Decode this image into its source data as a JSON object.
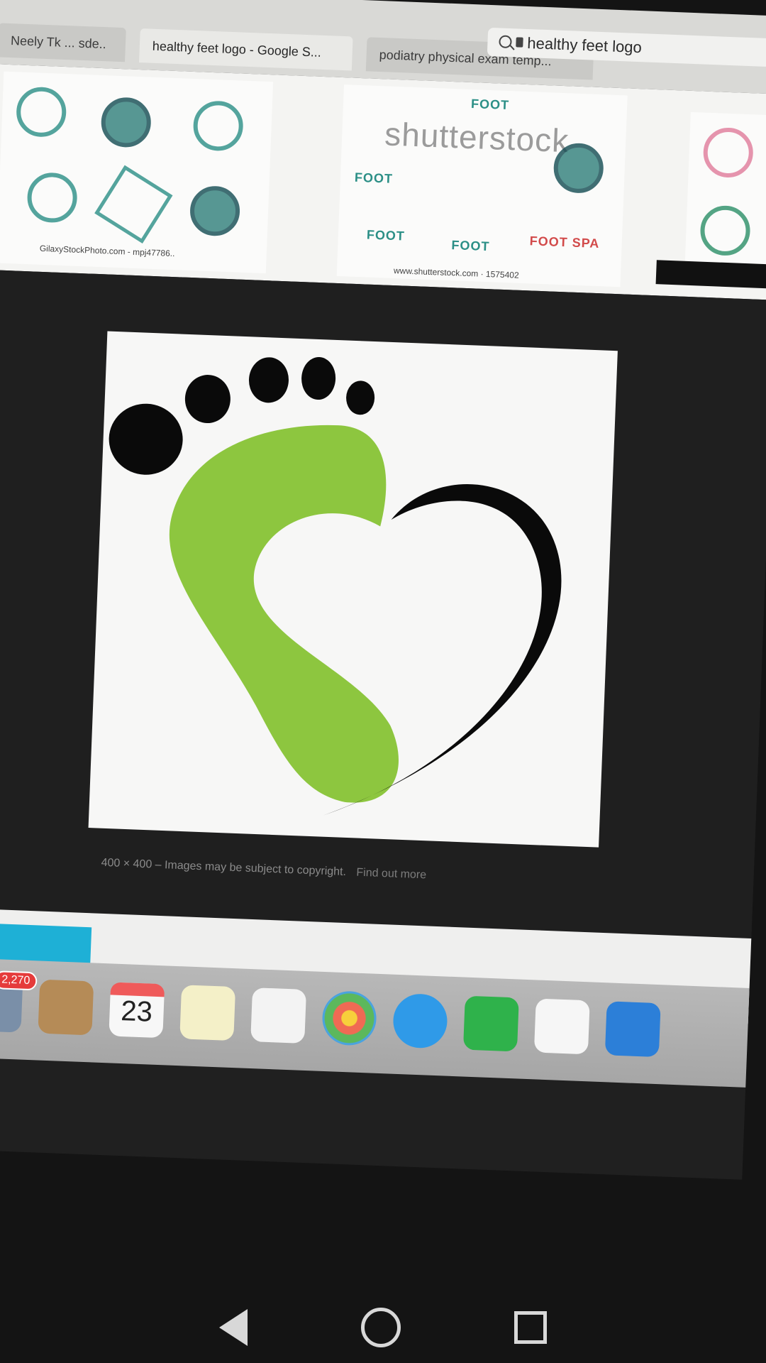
{
  "browser": {
    "tabs": [
      {
        "label": "Neely Tk  ... sde.."
      },
      {
        "label": "healthy feet logo - Google S..."
      },
      {
        "label": "podiatry physical exam temp..."
      }
    ],
    "address": "healthy feet logo"
  },
  "results": {
    "captions": [
      "GilaxyStockPhoto.com - mpj47786..",
      "www.shutterstock.com · 1575402"
    ],
    "watermark": "shutterstock",
    "foot_tags": [
      "FOOT",
      "FOOT",
      "FOOT",
      "FOOT",
      "FOOT SPA"
    ]
  },
  "preview": {
    "meta": "400 × 400 – Images may be subject to copyright.",
    "find_out_more": "Find out more",
    "colors": {
      "green": "#8dc63f",
      "black": "#0a0a0a"
    }
  },
  "dock": {
    "mail_badge": "2,270",
    "calendar_day": "23",
    "items": [
      "mail-icon",
      "notes-icon",
      "calendar-icon",
      "stickies-icon",
      "reminders-icon",
      "photos-icon",
      "messages-icon",
      "facetime-icon",
      "numbers-icon",
      "keynote-icon"
    ]
  }
}
